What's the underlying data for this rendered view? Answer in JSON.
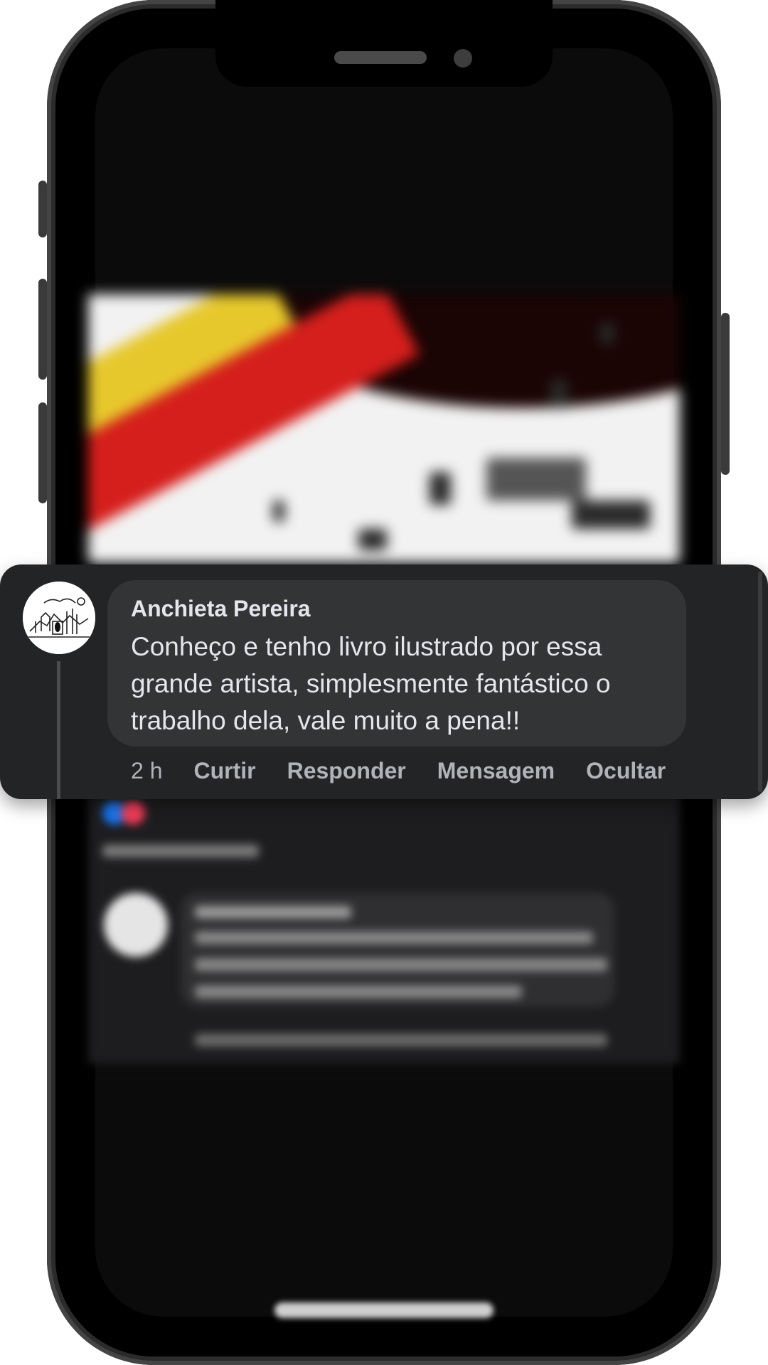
{
  "comment": {
    "author": "Anchieta Pereira",
    "text": "Conheço e tenho livro ilustrado por essa\ngrande artista,  simplesmente fantástico o\ntrabalho dela, vale muito a pena!!",
    "time": "2 h",
    "actions": {
      "like": "Curtir",
      "reply": "Responder",
      "message": "Mensagem",
      "hide": "Ocultar"
    }
  },
  "colors": {
    "card_background": "#232426",
    "bubble_background": "#333436",
    "text_primary": "#e4e6eb",
    "text_secondary": "#b0b3b8"
  },
  "icons": {
    "avatar": "sketch-avatar"
  }
}
